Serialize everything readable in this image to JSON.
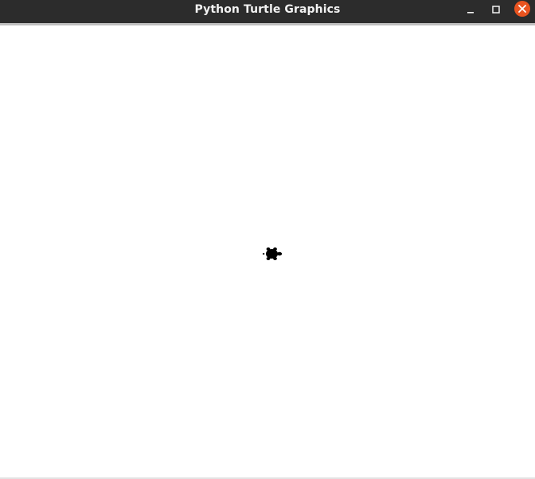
{
  "window": {
    "title": "Python Turtle Graphics"
  },
  "titlebar_buttons": {
    "minimize_icon": "minimize-icon",
    "maximize_icon": "maximize-icon",
    "close_icon": "close-icon"
  },
  "canvas": {
    "background": "#ffffff"
  },
  "turtle": {
    "shape": "turtle",
    "color": "#000000",
    "heading": "east"
  },
  "colors": {
    "titlebar": "#2c2c2c",
    "close_button": "#e95420",
    "title_text": "#f2f2f2"
  }
}
